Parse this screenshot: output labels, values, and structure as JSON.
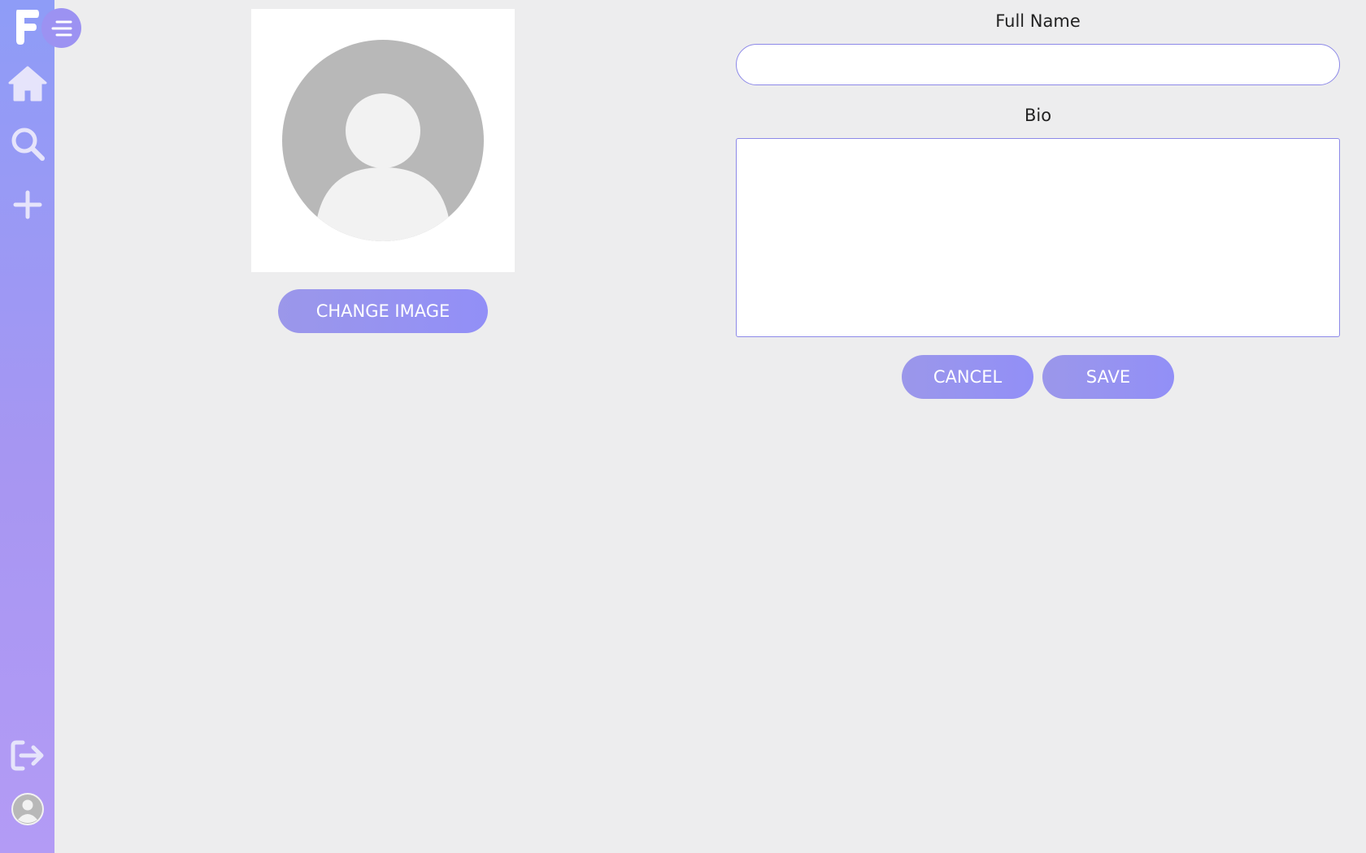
{
  "sidebar": {
    "logo_icon": "letter-f-logo-icon",
    "menu_icon": "hamburger-menu-icon",
    "items": [
      {
        "id": "home",
        "icon": "home-icon"
      },
      {
        "id": "search",
        "icon": "search-icon"
      },
      {
        "id": "add",
        "icon": "plus-icon"
      }
    ],
    "bottom_items": [
      {
        "id": "logout",
        "icon": "logout-icon"
      },
      {
        "id": "profile",
        "icon": "user-avatar-icon"
      }
    ]
  },
  "profile_image": {
    "placeholder_icon": "default-user-avatar-icon",
    "change_label": "CHANGE IMAGE"
  },
  "form": {
    "full_name": {
      "label": "Full Name",
      "value": "",
      "placeholder": ""
    },
    "bio": {
      "label": "Bio",
      "value": "",
      "placeholder": ""
    },
    "cancel_label": "CANCEL",
    "save_label": "SAVE"
  },
  "colors": {
    "accent": "#928ff7",
    "sidebar_top": "#8e9cf7",
    "sidebar_bottom": "#b39bf5",
    "background": "#ededee",
    "input_border": "#8d89e8"
  }
}
